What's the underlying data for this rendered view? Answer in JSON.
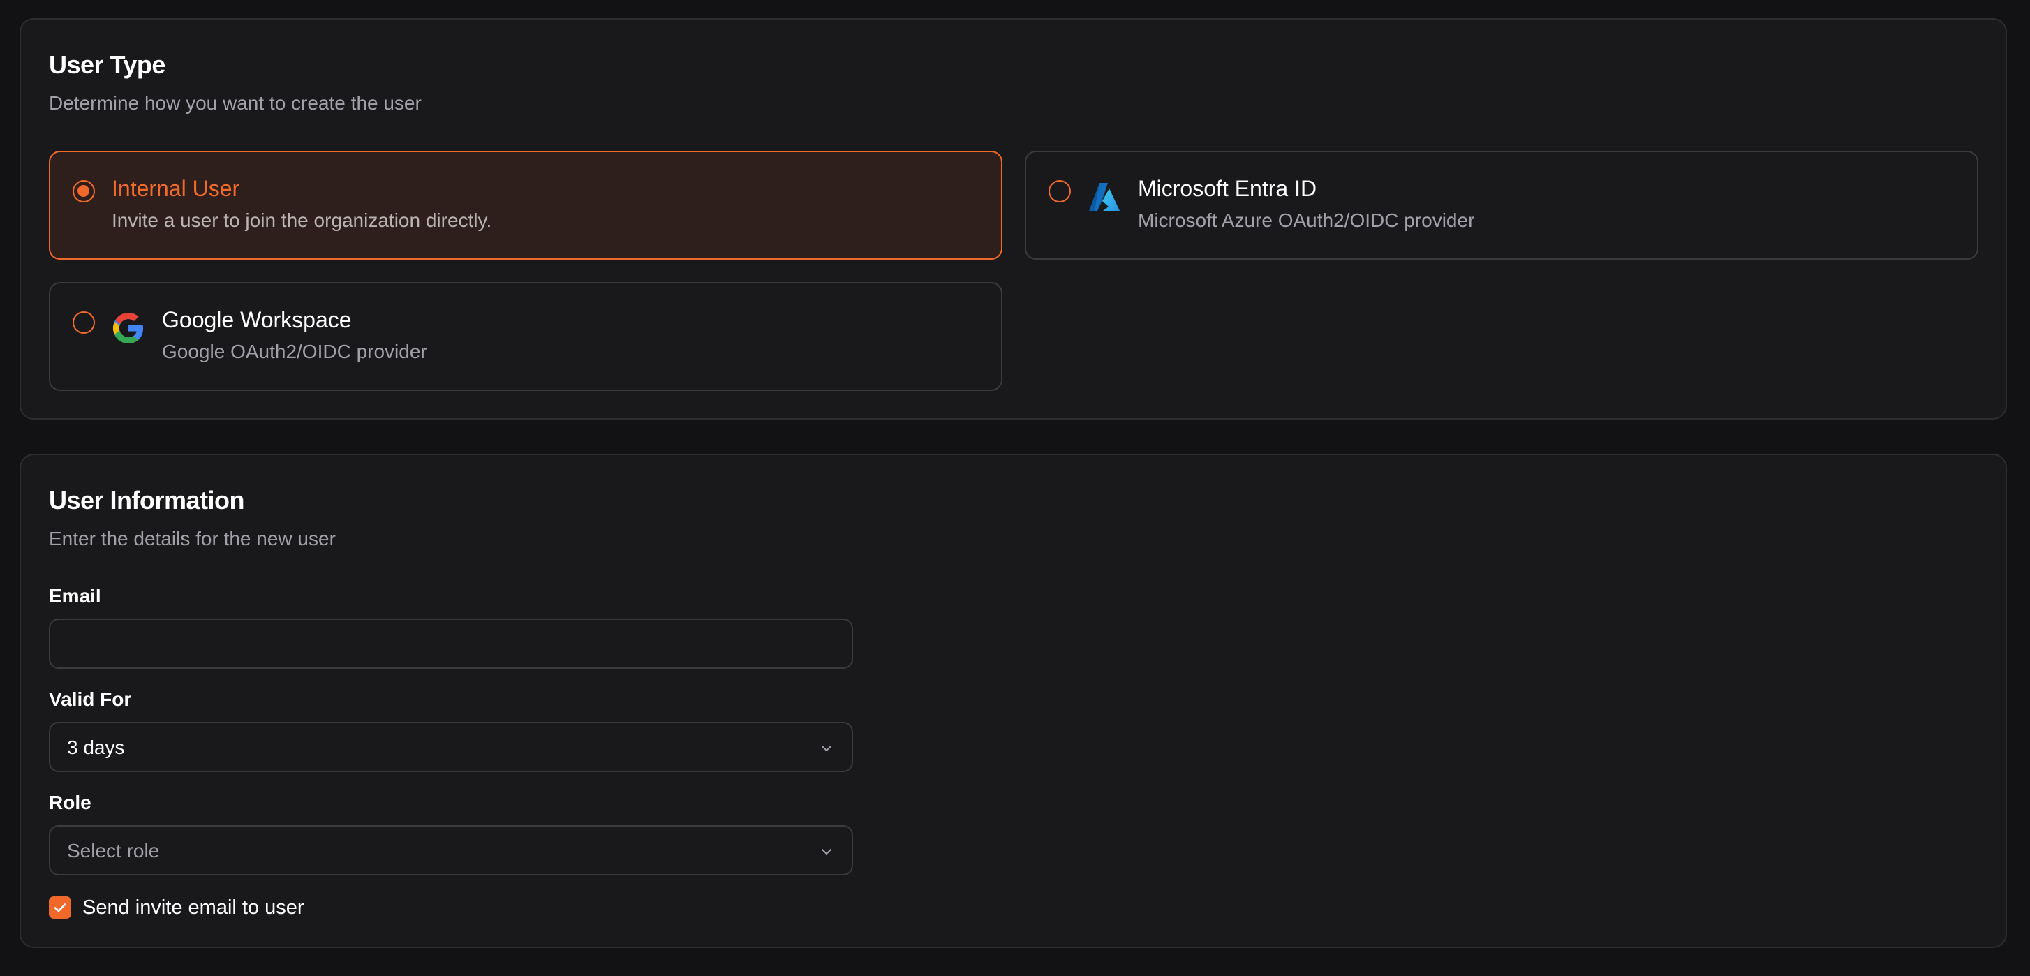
{
  "user_type": {
    "title": "User Type",
    "subtitle": "Determine how you want to create the user",
    "options": [
      {
        "title": "Internal User",
        "description": "Invite a user to join the organization directly.",
        "selected": true
      },
      {
        "title": "Microsoft Entra ID",
        "description": "Microsoft Azure OAuth2/OIDC provider",
        "icon": "microsoft-azure-logo-icon",
        "selected": false
      },
      {
        "title": "Google Workspace",
        "description": "Google OAuth2/OIDC provider",
        "icon": "google-logo-icon",
        "selected": false
      }
    ]
  },
  "user_information": {
    "title": "User Information",
    "subtitle": "Enter the details for the new user",
    "email": {
      "label": "Email",
      "value": "",
      "placeholder": ""
    },
    "valid_for": {
      "label": "Valid For",
      "value": "3 days"
    },
    "role": {
      "label": "Role",
      "placeholder": "Select role"
    },
    "send_invite": {
      "label": "Send invite email to user",
      "checked": true
    }
  },
  "colors": {
    "accent": "#f0692a",
    "background": "#121215",
    "card": "#19191b",
    "border": "#3a3a3f",
    "muted_text": "#a1a1aa",
    "selected_bg": "#2e1f1c"
  }
}
